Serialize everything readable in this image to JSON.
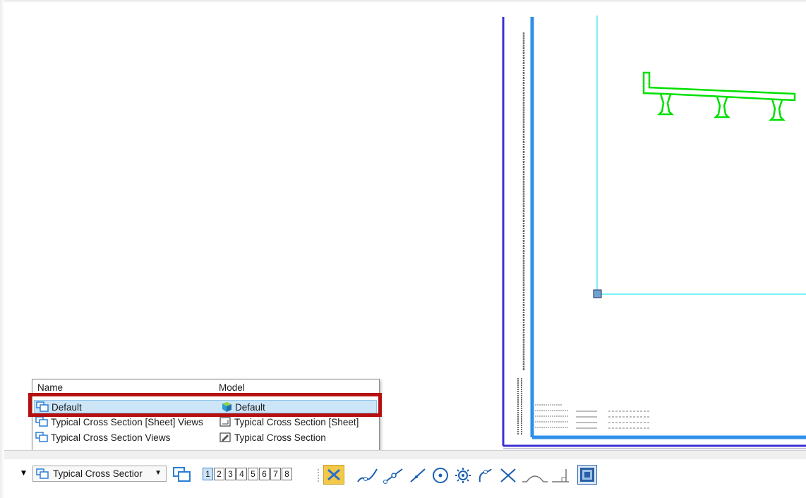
{
  "view_list": {
    "headers": {
      "name": "Name",
      "model": "Model"
    },
    "rows": [
      {
        "name": "Default",
        "model": "Default",
        "selected": true,
        "model_icon": "3d-model-icon"
      },
      {
        "name": "Typical Cross Section [Sheet] Views",
        "model": "Typical Cross Section [Sheet]",
        "selected": false,
        "model_icon": "sheet-model-icon"
      },
      {
        "name": "Typical Cross Section Views",
        "model": "Typical Cross Section",
        "selected": false,
        "model_icon": "drawing-model-icon"
      }
    ]
  },
  "toolbar": {
    "saved_view_combo": "Typical Cross Sectior",
    "view_buttons": [
      "1",
      "2",
      "3",
      "4",
      "5",
      "6",
      "7",
      "8"
    ],
    "active_view": "1",
    "snap_icons": [
      "snaps-toggle-icon",
      "keypoint-snap-icon",
      "midpoint-snap-icon",
      "nearest-snap-icon",
      "center-snap-icon",
      "origin-snap-icon",
      "tangent-snap-icon",
      "intersection-snap-icon",
      "bisector-snap-icon",
      "perpendicular-snap-icon",
      "accusnap-icon"
    ]
  },
  "colors": {
    "highlight": "#b50f10",
    "sheet_border_outer": "#3d2fd1",
    "sheet_border_inner": "#2f8fea",
    "cyan_lines": "#7ef0f5",
    "bridge": "#00e000"
  }
}
